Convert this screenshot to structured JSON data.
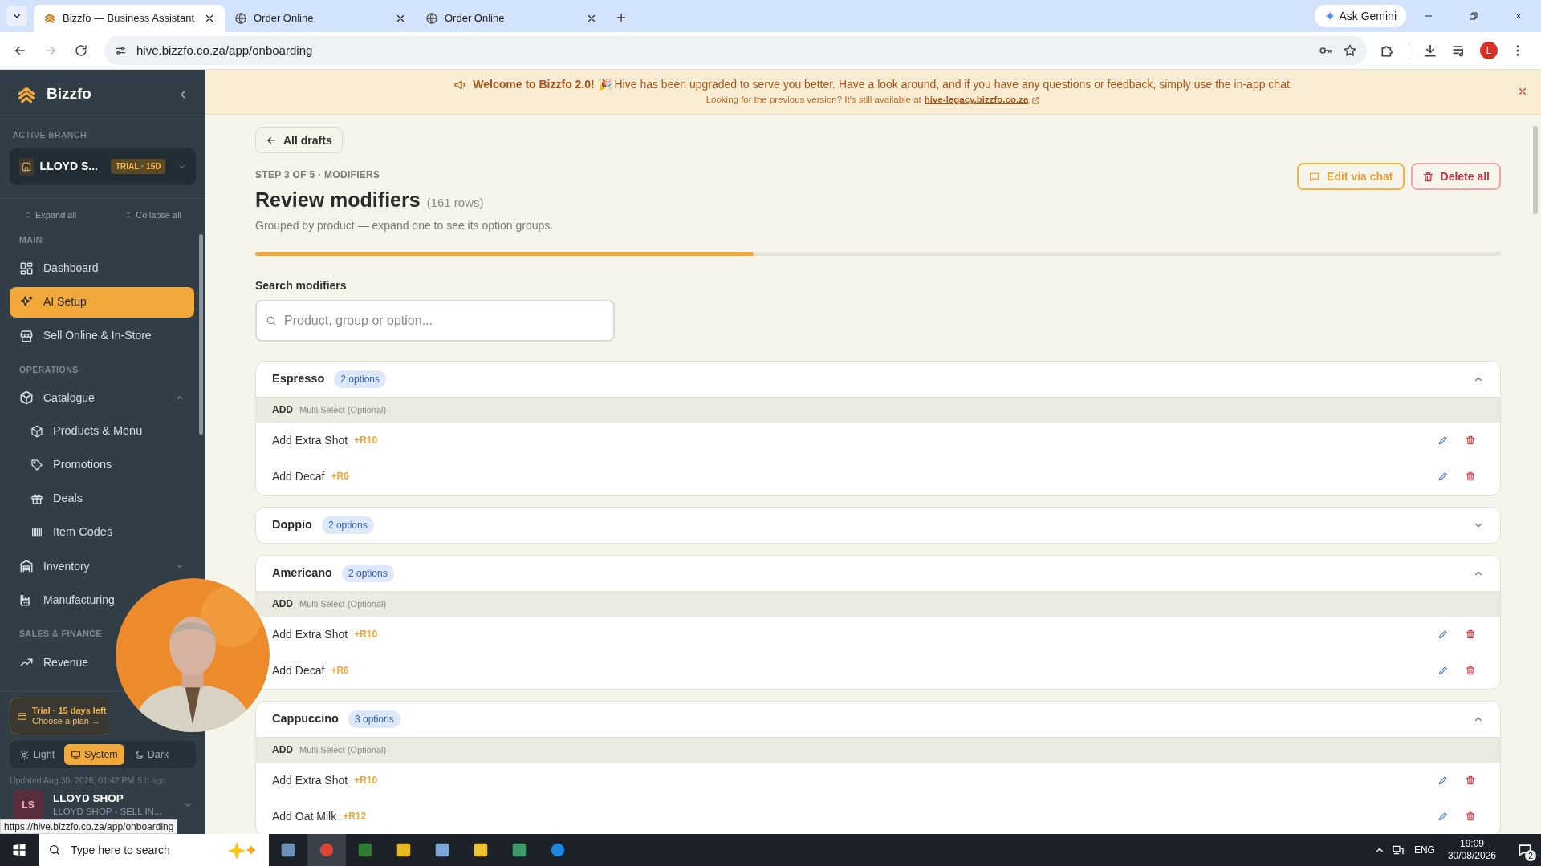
{
  "browser": {
    "tabs": [
      {
        "title": "Bizzfo — Business Assistant",
        "selected": true
      },
      {
        "title": "Order Online",
        "selected": false
      },
      {
        "title": "Order Online",
        "selected": false
      }
    ],
    "ask_gemini": "Ask Gemini",
    "url": "hive.bizzfo.co.za/app/onboarding",
    "profile_initial": "L"
  },
  "sidebar": {
    "brand": "Bizzfo",
    "branch_label": "ACTIVE BRANCH",
    "branch_name": "LLOYD S...",
    "branch_badge": "TRIAL · 15D",
    "expand_all": "Expand all",
    "collapse_all": "Collapse all",
    "sections": [
      {
        "label": "MAIN",
        "items": [
          {
            "label": "Dashboard",
            "selected": false
          },
          {
            "label": "AI Setup",
            "selected": true
          },
          {
            "label": "Sell Online & In-Store",
            "selected": false
          }
        ]
      },
      {
        "label": "OPERATIONS",
        "items": [
          {
            "label": "Catalogue",
            "selected": false,
            "expanded": true,
            "children": [
              {
                "label": "Products & Menu",
                "selected": false
              },
              {
                "label": "Promotions",
                "selected": false
              },
              {
                "label": "Deals",
                "selected": false
              },
              {
                "label": "Item Codes",
                "selected": false
              }
            ]
          },
          {
            "label": "Inventory",
            "selected": false,
            "expanded": false
          },
          {
            "label": "Manufacturing",
            "selected": false
          }
        ]
      },
      {
        "label": "SALES & FINANCE",
        "items": [
          {
            "label": "Revenue",
            "selected": false
          }
        ]
      }
    ],
    "trial": {
      "title": "Trial · 15 days left",
      "subtitle": "Choose a plan →"
    },
    "themes": [
      {
        "label": "Light",
        "selected": false
      },
      {
        "label": "System",
        "selected": true
      },
      {
        "label": "Dark",
        "selected": false
      }
    ],
    "updated": "Updated Aug 30, 2026, 01:42 PM",
    "updated_ago": "5 h ago",
    "user": {
      "initials": "LS",
      "name": "LLOYD SHOP",
      "subtitle": "LLOYD SHOP - SELL IN..."
    }
  },
  "banner": {
    "message": "**Welcome to Bizzfo 2.0!** 🎉 Hive has been upgraded to serve you better. Have a look around, and if you have any questions or feedback, simply use the in-app chat.",
    "legacy_text": "Looking for the previous version? It's still available at",
    "legacy_link": "hive-legacy.bizzfo.co.za"
  },
  "page": {
    "back": "All drafts",
    "step": "STEP 3 OF 5 · MODIFIERS",
    "title": "Review modifiers",
    "count": "(161 rows)",
    "subtitle": "Grouped by product — expand one to see its option groups.",
    "progress": {
      "level": 0.4
    },
    "edit_chat": "Edit via chat",
    "delete_all": "Delete all",
    "search_label": "Search modifiers",
    "search": {
      "placeholder": "Product, group or option..."
    },
    "groups": [
      {
        "name": "Espresso",
        "badge": "2 options",
        "expanded": true,
        "option_group": {
          "type": "ADD",
          "mode": "Multi Select (Optional)"
        },
        "options": [
          {
            "name": "Add Extra Shot",
            "price": "+R10"
          },
          {
            "name": "Add Decaf",
            "price": "+R6"
          }
        ]
      },
      {
        "name": "Doppio",
        "badge": "2 options",
        "expanded": false
      },
      {
        "name": "Americano",
        "badge": "2 options",
        "expanded": true,
        "option_group": {
          "type": "ADD",
          "mode": "Multi Select (Optional)"
        },
        "options": [
          {
            "name": "Add Extra Shot",
            "price": "+R10"
          },
          {
            "name": "Add Decaf",
            "price": "+R6"
          }
        ]
      },
      {
        "name": "Cappuccino",
        "badge": "3 options",
        "expanded": true,
        "option_group": {
          "type": "ADD",
          "mode": "Multi Select (Optional)"
        },
        "options": [
          {
            "name": "Add Extra Shot",
            "price": "+R10"
          },
          {
            "name": "Add Oat Milk",
            "price": "+R12"
          }
        ]
      }
    ]
  },
  "status_url": "https://hive.bizzfo.co.za/app/onboarding",
  "taskbar": {
    "search": {
      "placeholder": "Type here to search"
    },
    "language": "ENG",
    "time": "19:09",
    "date": "30/08/2026",
    "notifications": "2"
  }
}
